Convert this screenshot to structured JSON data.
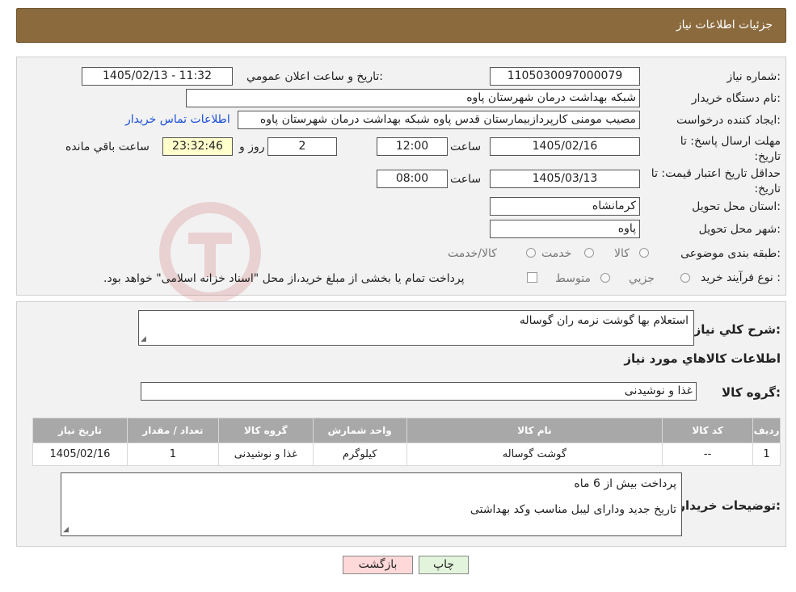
{
  "header": {
    "title": "جزئیات اطلاعات نیاز"
  },
  "need": {
    "number_label": "شماره نیاز:",
    "number": "1105030097000079",
    "announce_label": "تاريخ و ساعت اعلان عمومي:",
    "announce": "1405/02/13 - 11:32",
    "buyer_label": "نام دستگاه خريدار:",
    "buyer": "شبکه بهداشت درمان شهرستان پاوه",
    "creator_label": "ايجاد کننده درخواست:",
    "creator": "مصیب مومنی کارپردازبیمارستان قدس پاوه شبکه بهداشت درمان شهرستان پاوه",
    "contact_link": "اطلاعات تماس خريدار",
    "deadline_label": "مهلت ارسال پاسخ: تا تاريخ:",
    "deadline_date": "1405/02/16",
    "time_label": "ساعت",
    "deadline_time": "12:00",
    "days": "2",
    "days_label": "روز و",
    "remaining": "23:32:46",
    "remaining_label": "ساعت باقي مانده",
    "validity_label": "حداقل تاريخ اعتبار قيمت: تا تاريخ:",
    "validity_date": "1405/03/13",
    "validity_time": "08:00",
    "province_label": "استان محل تحويل:",
    "province": "کرمانشاه",
    "city_label": "شهر محل تحويل:",
    "city": "پاوه",
    "category_label": "طبقه بندی موضوعی:",
    "category_options": [
      "کالا",
      "خدمت",
      "کالا/خدمت"
    ],
    "process_label": "نوع فرآيند خريد :",
    "process_options": [
      "جزيي",
      "متوسط"
    ],
    "process_note": "پرداخت تمام يا بخشی از مبلغ خريد،از محل \"اسناد خزانه اسلامی\" خواهد بود."
  },
  "desc": {
    "label": "شرح کلي نياز:",
    "text": "استعلام بها گوشت نرمه ران گوساله",
    "items_title": "اطلاعات کالاهاي مورد نياز",
    "group_label": "گروه کالا:",
    "group": "غذا و نوشيدنی"
  },
  "table": {
    "headers": [
      "رديف",
      "کد کالا",
      "نام کالا",
      "واحد شمارش",
      "گروه کالا",
      "تعداد / مقدار",
      "تاريخ نياز"
    ],
    "rows": [
      [
        "1",
        "--",
        "گوشت گوساله",
        "کيلوگرم",
        "غذا و نوشيدنی",
        "1",
        "1405/02/16"
      ]
    ]
  },
  "notes": {
    "label": "توضيحات خريدار:",
    "line1": "پرداخت بیش از 6 ماه",
    "line2": "تاریخ جدید ودارای لیبل مناسب وکد بهداشتی"
  },
  "buttons": {
    "print": "چاپ",
    "back": "بازگشت"
  },
  "colors": {
    "header": "#8b6b3e",
    "link": "#1a4fd6",
    "remaining_bg": "#ffffcc",
    "table_header": "#a8a8a8"
  }
}
